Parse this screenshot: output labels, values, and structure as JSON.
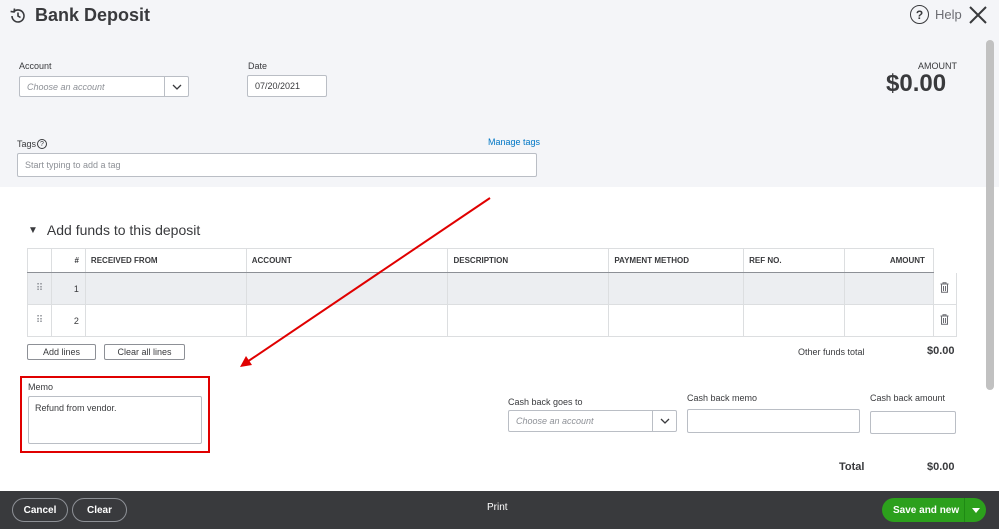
{
  "header": {
    "title": "Bank Deposit",
    "help_label": "Help"
  },
  "account": {
    "label": "Account",
    "placeholder": "Choose an account"
  },
  "date": {
    "label": "Date",
    "value": "07/20/2021"
  },
  "amount": {
    "label": "AMOUNT",
    "value": "$0.00"
  },
  "tags": {
    "label": "Tags",
    "placeholder": "Start typing to add a tag",
    "manage_label": "Manage tags"
  },
  "deposit_section": {
    "title": "Add funds to this deposit"
  },
  "table": {
    "columns": [
      "#",
      "RECEIVED FROM",
      "ACCOUNT",
      "DESCRIPTION",
      "PAYMENT METHOD",
      "REF NO.",
      "AMOUNT"
    ],
    "rows": [
      {
        "num": "1"
      },
      {
        "num": "2"
      }
    ]
  },
  "actions": {
    "add_lines": "Add lines",
    "clear_all_lines": "Clear all lines"
  },
  "other_funds": {
    "label": "Other funds total",
    "value": "$0.00"
  },
  "memo": {
    "label": "Memo",
    "value": "Refund from vendor."
  },
  "cash_back": {
    "goes_to_label": "Cash back goes to",
    "goes_to_placeholder": "Choose an account",
    "memo_label": "Cash back memo",
    "amount_label": "Cash back amount"
  },
  "total": {
    "label": "Total",
    "value": "$0.00"
  },
  "footer": {
    "cancel": "Cancel",
    "clear": "Clear",
    "print": "Print",
    "save": "Save and new"
  },
  "colors": {
    "accent_green": "#2ca01c",
    "link_blue": "#0077c5",
    "highlight_red": "#e00000",
    "footer_bg": "#393a3d"
  }
}
